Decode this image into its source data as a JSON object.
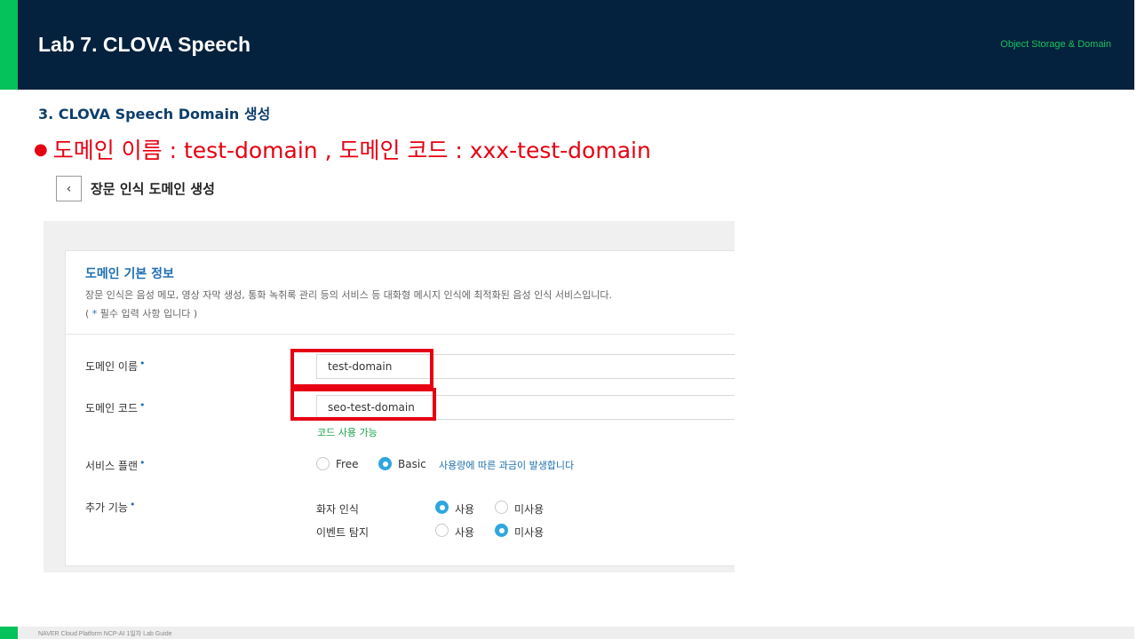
{
  "slide": {
    "title": "Lab 7. CLOVA Speech",
    "top_right": "Object Storage & Domain",
    "section_title": "3. CLOVA Speech Domain 생성",
    "bullet": "도메인 이름 : test-domain , 도메인 코드 : xxx-test-domain",
    "footer": "NAVER Cloud Platform NCP-AI 1일차 Lab Guide"
  },
  "page": {
    "back_icon": "‹",
    "title": "장문 인식 도메인 생성"
  },
  "card": {
    "heading": "도메인 기본 정보",
    "description": "장문 인식은 음성 메모, 영상 자막 생성, 통화 녹취록 관리 등의 서비스 등 대화형 메시지 인식에 최적화된 음성 인식 서비스입니다.",
    "required_prefix": "( ",
    "required_star": "*",
    "required_suffix": " 필수 입력 사항 입니다 )"
  },
  "form": {
    "domain_name_label": "도메인 이름",
    "domain_name_value": "test-domain",
    "domain_code_label": "도메인 코드",
    "domain_code_value": "seo-test-domain",
    "code_available": "코드 사용 가능",
    "plan_label": "서비스 플랜",
    "plan_free": "Free",
    "plan_basic": "Basic",
    "plan_note": "사용량에 따른 과금이 발생합니다",
    "extra_label": "추가 기능",
    "speaker_label": "화자 인식",
    "event_label": "이벤트 탐지",
    "use": "사용",
    "not_use": "미사용",
    "required_mark": "•"
  },
  "colors": {
    "header_bg": "#04223d",
    "accent_green": "#05c25b",
    "highlight_red": "#e60012",
    "radio_on": "#2ea6df",
    "link_blue": "#1f6fb2"
  }
}
